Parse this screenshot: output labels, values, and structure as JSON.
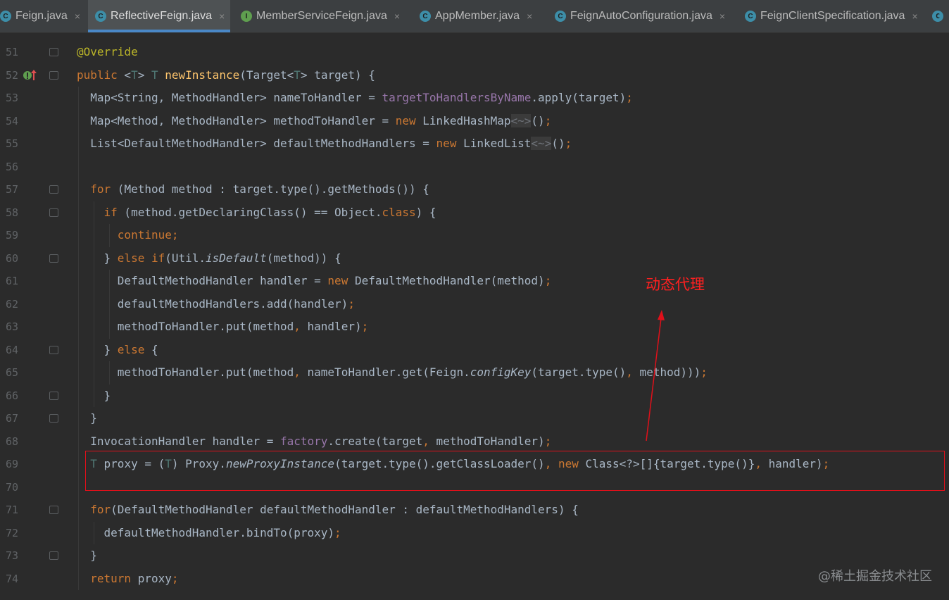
{
  "tabs": [
    {
      "label": "Feign.java",
      "icon": "class-icon",
      "active": false,
      "close": "×"
    },
    {
      "label": "ReflectiveFeign.java",
      "icon": "class-icon",
      "active": true,
      "close": "×"
    },
    {
      "label": "MemberServiceFeign.java",
      "icon": "interface-icon",
      "active": false,
      "close": "×"
    },
    {
      "label": "AppMember.java",
      "icon": "class-icon",
      "active": false,
      "close": "×"
    },
    {
      "label": "FeignAutoConfiguration.java",
      "icon": "class-icon",
      "active": false,
      "close": "×"
    },
    {
      "label": "FeignClientSpecification.java",
      "icon": "class-icon",
      "active": false,
      "close": "×"
    }
  ],
  "colors": {
    "keyword": "#cc7832",
    "function": "#ffc66d",
    "annotation": "#bbb529",
    "field": "#9876aa",
    "annotation_box": "#e0101a",
    "arrow": "#e0101a"
  },
  "code_lines": [
    {
      "n": "51",
      "tokens": [
        {
          "t": "@Override",
          "c": "an"
        }
      ]
    },
    {
      "n": "52",
      "tokens": [
        {
          "t": "public",
          "c": "kw"
        },
        {
          "t": " <"
        },
        {
          "t": "T",
          "c": "tp"
        },
        {
          "t": "> "
        },
        {
          "t": "T",
          "c": "tp"
        },
        {
          "t": " "
        },
        {
          "t": "newInstance",
          "c": "fn"
        },
        {
          "t": "(Target<"
        },
        {
          "t": "T",
          "c": "tp"
        },
        {
          "t": "> target) {"
        }
      ]
    },
    {
      "n": "53",
      "tokens": [
        {
          "t": "  Map<String, MethodHandler> nameToHandler = "
        },
        {
          "t": "targetToHandlersByName",
          "c": "fld"
        },
        {
          "t": ".apply(target)"
        },
        {
          "t": ";",
          "c": "kw"
        }
      ]
    },
    {
      "n": "54",
      "tokens": [
        {
          "t": "  Map<Method, MethodHandler> methodToHandler = "
        },
        {
          "t": "new",
          "c": "kw"
        },
        {
          "t": " LinkedHashMap"
        },
        {
          "t": "<~>",
          "c": "dm"
        },
        {
          "t": "()"
        },
        {
          "t": ";",
          "c": "kw"
        }
      ]
    },
    {
      "n": "55",
      "tokens": [
        {
          "t": "  List<DefaultMethodHandler> defaultMethodHandlers = "
        },
        {
          "t": "new",
          "c": "kw"
        },
        {
          "t": " LinkedList"
        },
        {
          "t": "<~>",
          "c": "dm"
        },
        {
          "t": "()"
        },
        {
          "t": ";",
          "c": "kw"
        }
      ]
    },
    {
      "n": "56",
      "tokens": []
    },
    {
      "n": "57",
      "tokens": [
        {
          "t": "  "
        },
        {
          "t": "for",
          "c": "kw"
        },
        {
          "t": " (Method method : target.type().getMethods()) {"
        }
      ]
    },
    {
      "n": "58",
      "tokens": [
        {
          "t": "    "
        },
        {
          "t": "if",
          "c": "kw"
        },
        {
          "t": " (method.getDeclaringClass() == Object."
        },
        {
          "t": "class",
          "c": "kw"
        },
        {
          "t": ") {"
        }
      ]
    },
    {
      "n": "59",
      "tokens": [
        {
          "t": "      "
        },
        {
          "t": "continue;",
          "c": "kw"
        }
      ]
    },
    {
      "n": "60",
      "tokens": [
        {
          "t": "    } "
        },
        {
          "t": "else if",
          "c": "kw"
        },
        {
          "t": "(Util."
        },
        {
          "t": "isDefault",
          "c": "it"
        },
        {
          "t": "(method)) {"
        }
      ]
    },
    {
      "n": "61",
      "tokens": [
        {
          "t": "      DefaultMethodHandler handler = "
        },
        {
          "t": "new",
          "c": "kw"
        },
        {
          "t": " DefaultMethodHandler(method)"
        },
        {
          "t": ";",
          "c": "kw"
        }
      ]
    },
    {
      "n": "62",
      "tokens": [
        {
          "t": "      defaultMethodHandlers.add(handler)"
        },
        {
          "t": ";",
          "c": "kw"
        }
      ]
    },
    {
      "n": "63",
      "tokens": [
        {
          "t": "      methodToHandler.put(method"
        },
        {
          "t": ",",
          "c": "kw"
        },
        {
          "t": " handler)"
        },
        {
          "t": ";",
          "c": "kw"
        }
      ]
    },
    {
      "n": "64",
      "tokens": [
        {
          "t": "    } "
        },
        {
          "t": "else",
          "c": "kw"
        },
        {
          "t": " {"
        }
      ]
    },
    {
      "n": "65",
      "tokens": [
        {
          "t": "      methodToHandler.put(method"
        },
        {
          "t": ",",
          "c": "kw"
        },
        {
          "t": " nameToHandler.get(Feign."
        },
        {
          "t": "configKey",
          "c": "it"
        },
        {
          "t": "(target.type()"
        },
        {
          "t": ",",
          "c": "kw"
        },
        {
          "t": " method)))"
        },
        {
          "t": ";",
          "c": "kw"
        }
      ]
    },
    {
      "n": "66",
      "tokens": [
        {
          "t": "    }"
        }
      ]
    },
    {
      "n": "67",
      "tokens": [
        {
          "t": "  }"
        }
      ]
    },
    {
      "n": "68",
      "tokens": [
        {
          "t": "  InvocationHandler handler = "
        },
        {
          "t": "factory",
          "c": "fld"
        },
        {
          "t": ".create(target"
        },
        {
          "t": ",",
          "c": "kw"
        },
        {
          "t": " methodToHandler)"
        },
        {
          "t": ";",
          "c": "kw"
        }
      ]
    },
    {
      "n": "69",
      "tokens": [
        {
          "t": "  "
        },
        {
          "t": "T",
          "c": "tp"
        },
        {
          "t": " proxy = ("
        },
        {
          "t": "T",
          "c": "tp"
        },
        {
          "t": ") Proxy."
        },
        {
          "t": "newProxyInstance",
          "c": "it"
        },
        {
          "t": "(target.type().getClassLoader()"
        },
        {
          "t": ",",
          "c": "kw"
        },
        {
          "t": " "
        },
        {
          "t": "new",
          "c": "kw"
        },
        {
          "t": " Class<?>[]{target.type()}"
        },
        {
          "t": ",",
          "c": "kw"
        },
        {
          "t": " handler)"
        },
        {
          "t": ";",
          "c": "kw"
        }
      ]
    },
    {
      "n": "70",
      "tokens": []
    },
    {
      "n": "71",
      "tokens": [
        {
          "t": "  "
        },
        {
          "t": "for",
          "c": "kw"
        },
        {
          "t": "(DefaultMethodHandler defaultMethodHandler : defaultMethodHandlers) {"
        }
      ]
    },
    {
      "n": "72",
      "tokens": [
        {
          "t": "    defaultMethodHandler.bindTo(proxy)"
        },
        {
          "t": ";",
          "c": "kw"
        }
      ]
    },
    {
      "n": "73",
      "tokens": [
        {
          "t": "  }"
        }
      ]
    },
    {
      "n": "74",
      "tokens": [
        {
          "t": "  "
        },
        {
          "t": "return",
          "c": "kw"
        },
        {
          "t": " proxy"
        },
        {
          "t": ";",
          "c": "kw"
        }
      ]
    }
  ],
  "annotation_note": "动态代理",
  "watermark": "@稀土掘金技术社区"
}
